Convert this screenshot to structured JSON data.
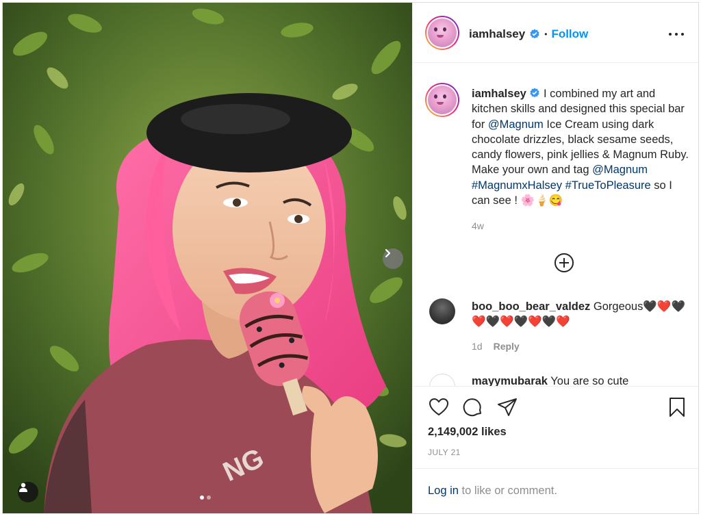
{
  "post": {
    "username": "iamhalsey",
    "follow_label": "Follow",
    "separator": "•",
    "caption": {
      "username": "iamhalsey",
      "part1": " I combined my art and kitchen skills and designed this special bar for ",
      "mention1": "@Magnum",
      "part2": " Ice Cream using dark chocolate drizzles, black sesame seeds, candy flowers, pink jellies & Magnum Ruby. Make your own and tag ",
      "mention2": "@Magnum",
      "hashtag1": "#MagnumxHalsey",
      "hashtag2": "#TrueToPleasure",
      "part3": " so I can see ! 🌸🍦😋"
    },
    "time_ago": "4w",
    "comments": [
      {
        "username": "boo_boo_bear_valdez",
        "text": " Gorgeous🖤❤️🖤❤️🖤❤️🖤❤️🖤❤️",
        "time": "1d",
        "reply_label": "Reply"
      },
      {
        "username": "mayymubarak",
        "text": " You are so cute"
      }
    ],
    "likes": "2,149,002 likes",
    "date": "JULY 21",
    "login_link": "Log in",
    "login_suffix": " to like or comment."
  },
  "carousel": {
    "slide_count": 2,
    "active_index": 0
  },
  "colors": {
    "follow_blue": "#0095f6",
    "link_blue": "#00376b",
    "verified_blue": "#3897f0",
    "muted": "#8e8e8e",
    "text": "#262626"
  },
  "icons": {
    "heart": "heart-icon",
    "comment": "comment-icon",
    "share": "share-icon",
    "save": "bookmark-icon",
    "more": "more-options-icon",
    "next": "chevron-right-icon",
    "tags": "user-tag-icon",
    "add": "plus-circle-icon",
    "verified": "verified-badge-icon"
  }
}
